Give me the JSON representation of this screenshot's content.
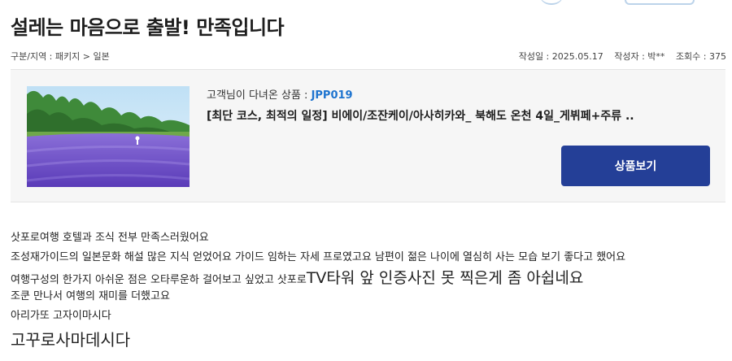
{
  "review": {
    "title": "설레는 마음으로 출발! 만족입니다",
    "breadcrumb": "구분/지역 : 패키지 > 일본",
    "meta": {
      "date": "작성일 : 2025.05.17",
      "author": "작성자 : 박**",
      "views": "조회수 : 375"
    }
  },
  "product": {
    "caption_label": "고객님이 다녀온 상품 : ",
    "code": "JPP019",
    "name": "[최단 코스, 최적의 일정] 비에이/조잔케이/아사히카와_ 북해도 온천 4일_게뷔페+주류 ..",
    "button_label": "상품보기",
    "image_icon": "lavender-field-photo"
  },
  "body": {
    "line1": "삿포로여행 호텔과 조식  전부 만족스러웠어요",
    "line2": "조성재가이드의 일본문화 해설 많은 지식 얻었어요 가이드 임하는 자세 프로였고요 남편이 젊은 나이에 열심히 사는 모습 보기 좋다고 했어요",
    "line3_small": "여행구성의 한가지 아쉬운 점은 오타루운하 걸어보고 싶었고 삿포로",
    "line3_large": "TV타워 앞 인증사진 못 찍은게 좀 아쉽네요",
    "line4": "조쿤 만나서 여행의 재미를 더했고요",
    "line5": "아리가또 고자이마시다",
    "line6": "고꾸로사마데시다"
  },
  "colors": {
    "accent_button": "#243f97",
    "code_link": "#1e74cf",
    "panel_bg": "#f6f6f6"
  }
}
